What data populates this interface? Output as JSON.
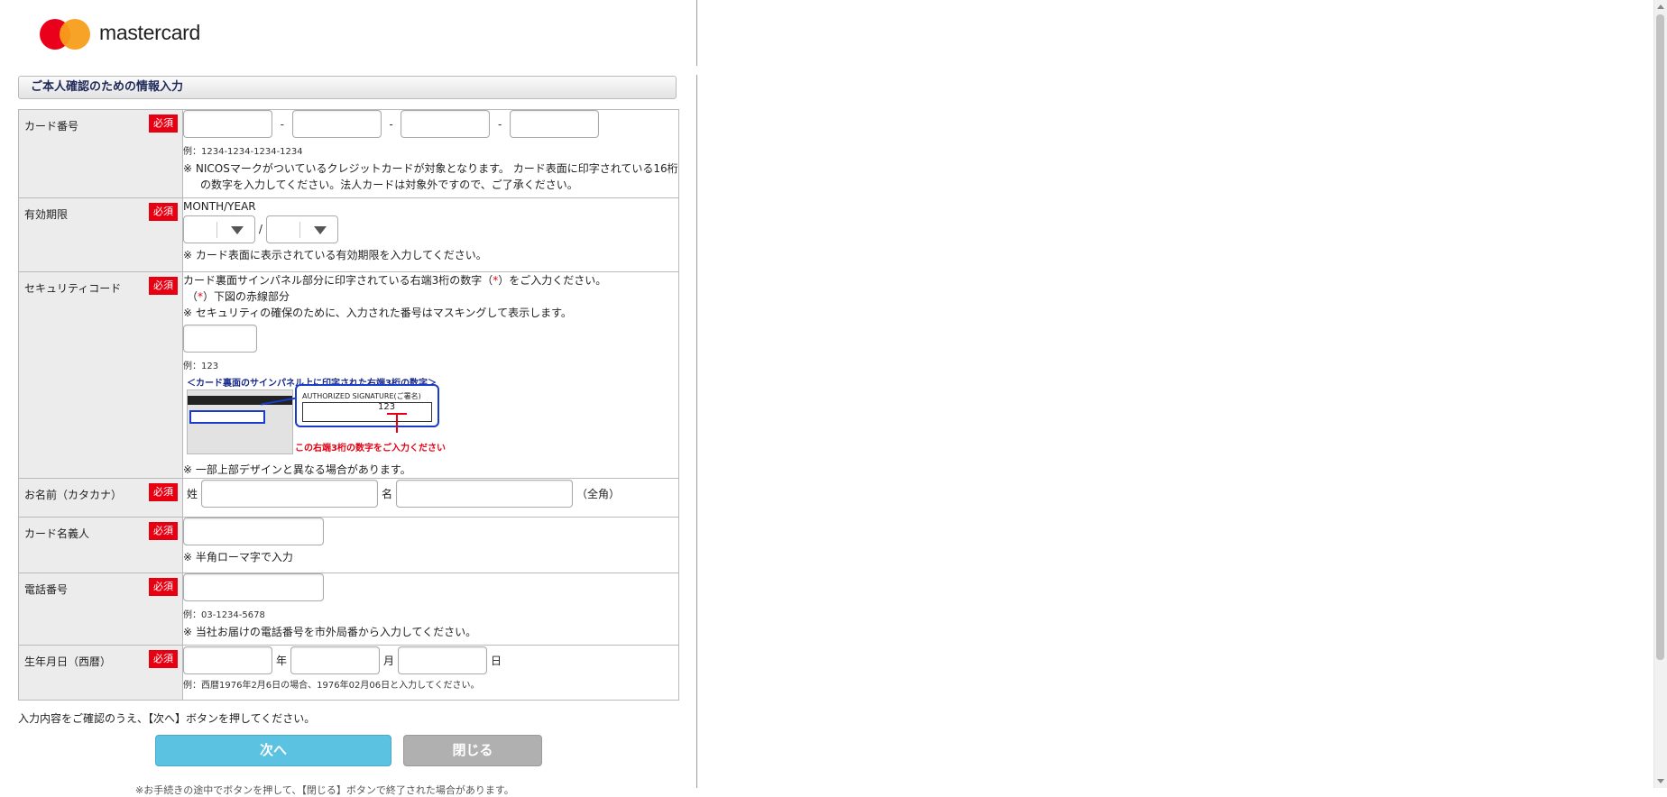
{
  "brand": {
    "name": "mastercard"
  },
  "section": {
    "title": "ご本人確認のための情報入力"
  },
  "required_badge": "必須",
  "card_number": {
    "label": "カード番号",
    "sep": "-",
    "example": "例：1234-1234-1234-1234",
    "note": "※ NICOSマークがついているクレジットカードが対象となります。 カード表面に印字されている16桁の数字を入力してください。法人カードは対象外ですので、ご了承ください。"
  },
  "expiry": {
    "label": "有効期限",
    "format": "MONTH/YEAR",
    "sep": "/",
    "note": "※ カード表面に表示されている有効期限を入力してください。"
  },
  "security_code": {
    "label": "セキュリティコード",
    "text_before": "カード裏面サインパネル部分に印字されている右端3桁の数字（",
    "asterisk": "*",
    "text_after": "）をご入力ください。",
    "sub_open": "（",
    "sub_close": "）下図の赤線部分",
    "mask_note": "※ セキュリティの確保のために、入力された番号はマスキングして表示します。",
    "example": "例：123",
    "image": {
      "title": "＜カード裏面のサインパネル上に印字された右端3桁の数字＞",
      "sig_label": "AUTHORIZED  SIGNATURE(ご署名)",
      "sample_digits": "123",
      "caption": "この右端3桁の数字をご入力ください"
    },
    "design_note": "※ 一部上部デザインと異なる場合があります。"
  },
  "name_kana": {
    "label": "お名前（カタカナ）",
    "last": "姓",
    "first": "名",
    "width_note": "（全角）"
  },
  "card_holder": {
    "label": "カード名義人",
    "note": "※ 半角ローマ字で入力"
  },
  "phone": {
    "label": "電話番号",
    "example": "例：03-1234-5678",
    "note": "※ 当社お届けの電話番号を市外局番から入力してください。"
  },
  "birthday": {
    "label": "生年月日（西暦）",
    "year": "年",
    "month": "月",
    "day": "日",
    "example": "例：西暦1976年2月6日の場合、1976年02月06日と入力してください。"
  },
  "footer": {
    "instruction": "入力内容をご確認のうえ、【次へ】ボタンを押してください。",
    "next": "次へ",
    "close": "閉じる",
    "cut_text": "※お手続きの途中でボタンを押して、【閉じる】ボタンで終了された場合があります。"
  },
  "colors": {
    "required": "#e60012",
    "next_button": "#5bc2e1",
    "close_button": "#b0b0b0",
    "label_bg": "#ececec"
  }
}
